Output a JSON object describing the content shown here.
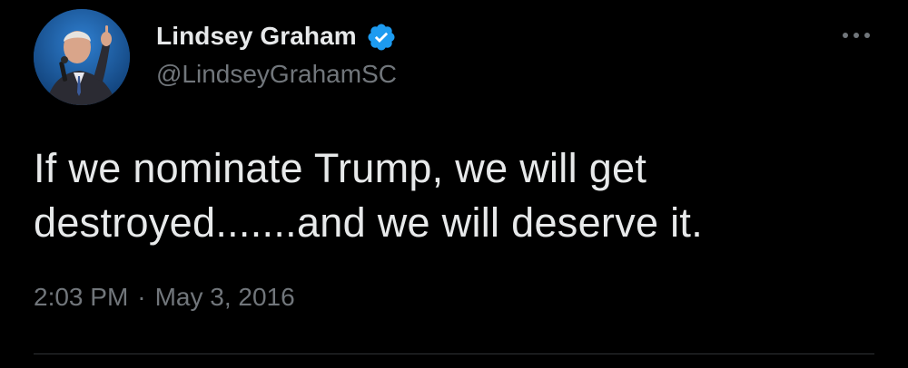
{
  "author": {
    "display_name": "Lindsey Graham",
    "handle": "@LindseyGrahamSC",
    "verified": true,
    "avatar_icon": "profile-photo"
  },
  "tweet": {
    "text": "If we nominate Trump, we will get\ndestroyed.......and we will deserve it.",
    "time": "2:03 PM",
    "separator": "·",
    "date": "May 3, 2016"
  },
  "icons": {
    "verified_badge": "verified-badge-icon",
    "more_menu": "more-options-icon"
  },
  "colors": {
    "background": "#000000",
    "primary_text": "#e7e9ea",
    "secondary_text": "#71767b",
    "verified_blue": "#1d9bf0",
    "divider": "#2f3336"
  }
}
